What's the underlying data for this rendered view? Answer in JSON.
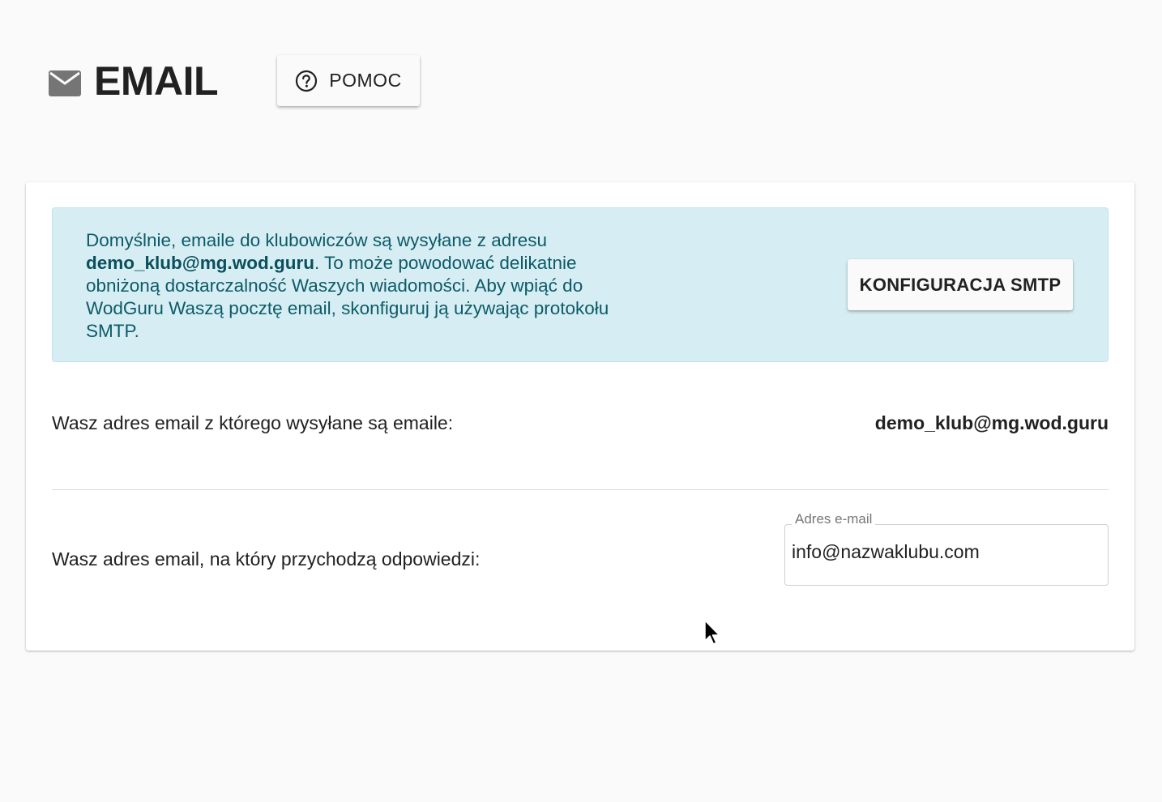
{
  "header": {
    "title": "EMAIL",
    "icon": "mail-icon",
    "help_button_label": "POMOC",
    "help_icon": "help-circle-icon"
  },
  "alert": {
    "text_before": "Domyślnie, emaile do klubowiczów są wysyłane z adresu ",
    "email": "demo_klub@mg.wod.guru",
    "text_after": ". To może powodować delikatnie obniżoną dostarczalność Waszych wiadomości. Aby wpiąć do WodGuru Waszą pocztę email, skonfiguruj ją używając protokołu SMTP.",
    "smtp_button_label": "KONFIGURACJA SMTP",
    "background_color": "#d6eef3",
    "text_color": "#0d5a68"
  },
  "sender": {
    "label": "Wasz adres email z którego wysyłane są emaile:",
    "value": "demo_klub@mg.wod.guru"
  },
  "reply": {
    "label": "Wasz adres email, na który przychodzą odpowiedzi:",
    "field_label": "Adres e-mail",
    "field_value": "info@nazwaklubu.com"
  }
}
